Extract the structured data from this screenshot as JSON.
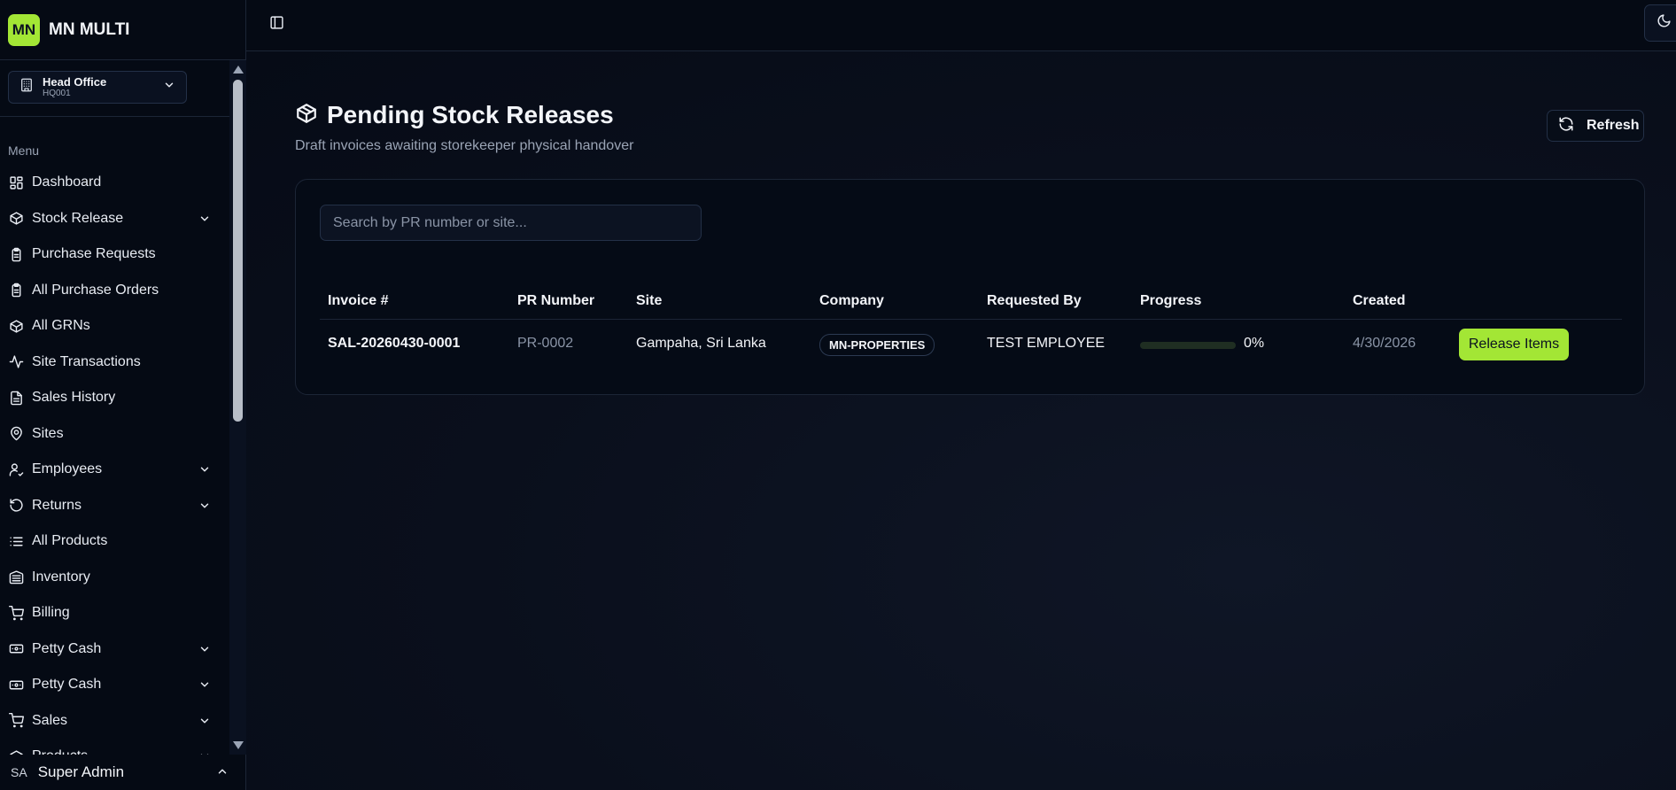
{
  "brand": {
    "logo_text": "MN",
    "name": "MN MULTI"
  },
  "branch": {
    "name": "Head Office",
    "code": "HQ001"
  },
  "sidebar": {
    "menu_label": "Menu",
    "items": [
      {
        "label": "Dashboard",
        "icon": "dashboard-icon",
        "expandable": false
      },
      {
        "label": "Stock Release",
        "icon": "package-icon",
        "expandable": true
      },
      {
        "label": "Purchase Requests",
        "icon": "clipboard-icon",
        "expandable": false
      },
      {
        "label": "All Purchase Orders",
        "icon": "clipboard-icon",
        "expandable": false
      },
      {
        "label": "All GRNs",
        "icon": "package-icon",
        "expandable": false
      },
      {
        "label": "Site Transactions",
        "icon": "activity-icon",
        "expandable": false
      },
      {
        "label": "Sales History",
        "icon": "document-icon",
        "expandable": false
      },
      {
        "label": "Sites",
        "icon": "map-pin-icon",
        "expandable": false
      },
      {
        "label": "Employees",
        "icon": "user-check-icon",
        "expandable": true
      },
      {
        "label": "Returns",
        "icon": "rotate-icon",
        "expandable": true
      },
      {
        "label": "All Products",
        "icon": "list-icon",
        "expandable": false
      },
      {
        "label": "Inventory",
        "icon": "warehouse-icon",
        "expandable": false
      },
      {
        "label": "Billing",
        "icon": "cart-icon",
        "expandable": false
      },
      {
        "label": "Petty Cash",
        "icon": "banknote-icon",
        "expandable": true
      },
      {
        "label": "Petty Cash",
        "icon": "banknote-icon",
        "expandable": true
      },
      {
        "label": "Sales",
        "icon": "cart-icon",
        "expandable": true
      },
      {
        "label": "Products",
        "icon": "package-icon",
        "expandable": true
      }
    ]
  },
  "user": {
    "avatar": "SA",
    "name": "Super Admin"
  },
  "page": {
    "title": "Pending Stock Releases",
    "subtitle": "Draft invoices awaiting storekeeper physical handover",
    "refresh_label": "Refresh",
    "search_placeholder": "Search by PR number or site..."
  },
  "table": {
    "headers": [
      "Invoice #",
      "PR Number",
      "Site",
      "Company",
      "Requested By",
      "Progress",
      "Created"
    ],
    "rows": [
      {
        "invoice": "SAL-20260430-0001",
        "pr_number": "PR-0002",
        "site": "Gampaha, Sri Lanka",
        "company": "MN-PROPERTIES",
        "requested_by": "TEST EMPLOYEE",
        "progress_value": 0,
        "progress_label": "0%",
        "created": "4/30/2026",
        "action_label": "Release Items"
      }
    ]
  },
  "colors": {
    "accent": "#a3e635",
    "background": "#060b16"
  }
}
